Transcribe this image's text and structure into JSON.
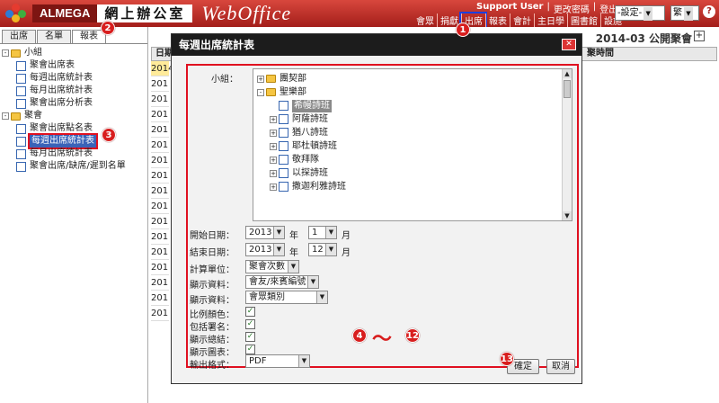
{
  "header": {
    "brand": "ALMEGA",
    "brand_cn": "網上辦公室",
    "product": "WebOffice",
    "user": "Support User",
    "links": [
      "更改密碼",
      "登出"
    ],
    "setting_select": "-設定-",
    "lang_select": "繁",
    "help": "?",
    "nav": [
      "會眾",
      "捐獻",
      "出席",
      "報表",
      "會計",
      "主日學",
      "圖書館",
      "設施"
    ],
    "active_nav_index": 2
  },
  "sidebar": {
    "tabs": [
      "出席",
      "名單",
      "報表"
    ],
    "active_tab": 2,
    "groups": [
      {
        "label": "小組",
        "items": [
          "聚會出席表",
          "每週出席統計表",
          "每月出席統計表",
          "聚會出席分析表"
        ]
      },
      {
        "label": "聚會",
        "items": [
          "聚會出席點名表",
          "每週出席統計表",
          "每月出席統計表",
          "聚會出席/缺席/遲到名單"
        ],
        "selected_index": 1
      }
    ]
  },
  "main": {
    "title": "2014-03 公開聚會",
    "plus": "+",
    "col_date": "日期",
    "col_time": "聚時間",
    "rows": [
      "2014",
      "201",
      "201",
      "201",
      "201",
      "201",
      "201",
      "201",
      "201",
      "201",
      "201",
      "201",
      "201",
      "201",
      "201",
      "201",
      "201"
    ]
  },
  "dialog": {
    "title": "每週出席統計表",
    "close": "✕",
    "group_label": "小組：",
    "tree": [
      {
        "label": "團契部",
        "level": 0,
        "sign": "+",
        "type": "folder"
      },
      {
        "label": "聖樂部",
        "level": 0,
        "sign": "-",
        "type": "folder"
      },
      {
        "label": "希幔詩班",
        "level": 1,
        "sign": "",
        "type": "doc",
        "selected": true
      },
      {
        "label": "阿薩詩班",
        "level": 1,
        "sign": "+",
        "type": "doc"
      },
      {
        "label": "猶八詩班",
        "level": 1,
        "sign": "+",
        "type": "doc"
      },
      {
        "label": "耶杜頓詩班",
        "level": 1,
        "sign": "+",
        "type": "doc"
      },
      {
        "label": "敬拜隊",
        "level": 1,
        "sign": "+",
        "type": "doc"
      },
      {
        "label": "以探詩班",
        "level": 1,
        "sign": "+",
        "type": "doc"
      },
      {
        "label": "撒迦利雅詩班",
        "level": 1,
        "sign": "+",
        "type": "doc"
      }
    ],
    "start_date_label": "開始日期：",
    "start_year": "2013",
    "start_month": "1",
    "end_date_label": "結束日期：",
    "end_year": "2013",
    "end_month": "12",
    "year_unit": "年",
    "month_unit": "月",
    "calc_unit_label": "計算單位：",
    "calc_unit": "聚會次數",
    "display1_label": "顯示資料：",
    "display1": "會友/來賓編號",
    "display2_label": "顯示資料：",
    "display2": "會眾類別",
    "ratio_color_label": "比例顏色：",
    "include_names_label": "包括署名：",
    "show_summary_label": "顯示總結：",
    "show_chart_label": "顯示圖表：",
    "output_label": "輸出格式：",
    "output_format": "PDF",
    "ok": "確定",
    "cancel": "取消"
  },
  "callouts": {
    "b1": "1",
    "b2": "2",
    "b3": "3",
    "b4": "4",
    "b12": "12",
    "b13": "13",
    "tilde": "～"
  }
}
